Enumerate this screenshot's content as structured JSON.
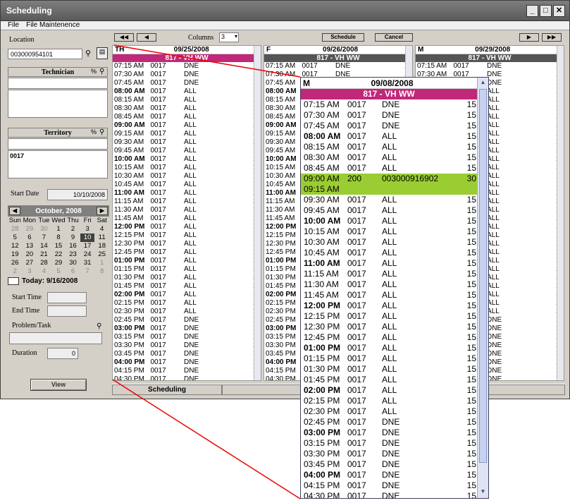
{
  "window": {
    "title": "Scheduling",
    "buttons": [
      "_",
      "□",
      "✕"
    ]
  },
  "menu": [
    "File",
    "File Maintenence"
  ],
  "left": {
    "location_label": "Location",
    "location_value": "003000954101",
    "technician_label": "Technician",
    "territory_label": "Territory",
    "territory_value": "0017",
    "pct": "%",
    "start_date_label": "Start Date",
    "start_date_value": "10/10/2008",
    "calendar": {
      "month": "October, 2008",
      "weekdays": [
        "Sun",
        "Mon",
        "Tue",
        "Wed",
        "Thu",
        "Fri",
        "Sat"
      ],
      "days": [
        [
          "28",
          "29",
          "30",
          "1",
          "2",
          "3",
          "4"
        ],
        [
          "5",
          "6",
          "7",
          "8",
          "9",
          "10",
          "11"
        ],
        [
          "12",
          "13",
          "14",
          "15",
          "16",
          "17",
          "18"
        ],
        [
          "19",
          "20",
          "21",
          "22",
          "23",
          "24",
          "25"
        ],
        [
          "26",
          "27",
          "28",
          "29",
          "30",
          "31",
          "1"
        ],
        [
          "2",
          "3",
          "4",
          "5",
          "6",
          "7",
          "8"
        ]
      ],
      "today": "Today: 9/16/2008"
    },
    "start_time_label": "Start Time",
    "end_time_label": "End Time",
    "problem_label": "Problem/Task",
    "duration_label": "Duration",
    "duration_value": "0",
    "view_button": "View"
  },
  "toolbar": {
    "columns_label": "Columns",
    "columns_value": "3",
    "schedule": "Schedule",
    "cancel": "Cancel"
  },
  "columns": [
    {
      "day": "TH",
      "date": "09/25/2008",
      "band": "817 - VH WW",
      "band_color": "#c0287a"
    },
    {
      "day": "F",
      "date": "09/26/2008",
      "band": "817 - VH WW",
      "band_color": "#555555"
    },
    {
      "day": "M",
      "date": "09/29/2008",
      "band": "817 - VH WW",
      "band_color": "#555555"
    }
  ],
  "rows": [
    [
      "07:15 AM",
      "0017",
      "DNE",
      "15"
    ],
    [
      "07:30 AM",
      "0017",
      "DNE",
      "15"
    ],
    [
      "07:45 AM",
      "0017",
      "DNE",
      "15"
    ],
    [
      "08:00 AM",
      "0017",
      "ALL",
      "15"
    ],
    [
      "08:15 AM",
      "0017",
      "ALL",
      "15"
    ],
    [
      "08:30 AM",
      "0017",
      "ALL",
      "15"
    ],
    [
      "08:45 AM",
      "0017",
      "ALL",
      "15"
    ],
    [
      "09:00 AM",
      "0017",
      "ALL",
      "15"
    ],
    [
      "09:15 AM",
      "0017",
      "ALL",
      "15"
    ],
    [
      "09:30 AM",
      "0017",
      "ALL",
      "15"
    ],
    [
      "09:45 AM",
      "0017",
      "ALL",
      "15"
    ],
    [
      "10:00 AM",
      "0017",
      "ALL",
      "15"
    ],
    [
      "10:15 AM",
      "0017",
      "ALL",
      "15"
    ],
    [
      "10:30 AM",
      "0017",
      "ALL",
      "15"
    ],
    [
      "10:45 AM",
      "0017",
      "ALL",
      "15"
    ],
    [
      "11:00 AM",
      "0017",
      "ALL",
      "15"
    ],
    [
      "11:15 AM",
      "0017",
      "ALL",
      "15"
    ],
    [
      "11:30 AM",
      "0017",
      "ALL",
      "15"
    ],
    [
      "11:45 AM",
      "0017",
      "ALL",
      "15"
    ],
    [
      "12:00 PM",
      "0017",
      "ALL",
      "15"
    ],
    [
      "12:15 PM",
      "0017",
      "ALL",
      "15"
    ],
    [
      "12:30 PM",
      "0017",
      "ALL",
      "15"
    ],
    [
      "12:45 PM",
      "0017",
      "ALL",
      "15"
    ],
    [
      "01:00 PM",
      "0017",
      "ALL",
      "15"
    ],
    [
      "01:15 PM",
      "0017",
      "ALL",
      "15"
    ],
    [
      "01:30 PM",
      "0017",
      "ALL",
      "15"
    ],
    [
      "01:45 PM",
      "0017",
      "ALL",
      "15"
    ],
    [
      "02:00 PM",
      "0017",
      "ALL",
      "15"
    ],
    [
      "02:15 PM",
      "0017",
      "ALL",
      "15"
    ],
    [
      "02:30 PM",
      "0017",
      "ALL",
      "15"
    ],
    [
      "02:45 PM",
      "0017",
      "DNE",
      "15"
    ],
    [
      "03:00 PM",
      "0017",
      "DNE",
      "15"
    ],
    [
      "03:15 PM",
      "0017",
      "DNE",
      "15"
    ],
    [
      "03:30 PM",
      "0017",
      "DNE",
      "15"
    ],
    [
      "03:45 PM",
      "0017",
      "DNE",
      "15"
    ],
    [
      "04:00 PM",
      "0017",
      "DNE",
      "15"
    ],
    [
      "04:15 PM",
      "0017",
      "DNE",
      "15"
    ],
    [
      "04:30 PM",
      "0017",
      "DNE",
      "15"
    ]
  ],
  "popup": {
    "day": "M",
    "date": "09/08/2008",
    "band": "817 - VH WW",
    "band_color": "#c0287a",
    "highlight_color": "#9acd32",
    "rows": [
      [
        "07:15 AM",
        "0017",
        "DNE",
        "15"
      ],
      [
        "07:30 AM",
        "0017",
        "DNE",
        "15"
      ],
      [
        "07:45 AM",
        "0017",
        "DNE",
        "15"
      ],
      [
        "08:00 AM",
        "0017",
        "ALL",
        "15"
      ],
      [
        "08:15 AM",
        "0017",
        "ALL",
        "15"
      ],
      [
        "08:30 AM",
        "0017",
        "ALL",
        "15"
      ],
      [
        "08:45 AM",
        "0017",
        "ALL",
        "15"
      ],
      [
        "09:00 AM",
        "200",
        "003000916902",
        "30"
      ],
      [
        "09:15 AM",
        "",
        "",
        ""
      ],
      [
        "09:30 AM",
        "0017",
        "ALL",
        "15"
      ],
      [
        "09:45 AM",
        "0017",
        "ALL",
        "15"
      ],
      [
        "10:00 AM",
        "0017",
        "ALL",
        "15"
      ],
      [
        "10:15 AM",
        "0017",
        "ALL",
        "15"
      ],
      [
        "10:30 AM",
        "0017",
        "ALL",
        "15"
      ],
      [
        "10:45 AM",
        "0017",
        "ALL",
        "15"
      ],
      [
        "11:00 AM",
        "0017",
        "ALL",
        "15"
      ],
      [
        "11:15 AM",
        "0017",
        "ALL",
        "15"
      ],
      [
        "11:30 AM",
        "0017",
        "ALL",
        "15"
      ],
      [
        "11:45 AM",
        "0017",
        "ALL",
        "15"
      ],
      [
        "12:00 PM",
        "0017",
        "ALL",
        "15"
      ],
      [
        "12:15 PM",
        "0017",
        "ALL",
        "15"
      ],
      [
        "12:30 PM",
        "0017",
        "ALL",
        "15"
      ],
      [
        "12:45 PM",
        "0017",
        "ALL",
        "15"
      ],
      [
        "01:00 PM",
        "0017",
        "ALL",
        "15"
      ],
      [
        "01:15 PM",
        "0017",
        "ALL",
        "15"
      ],
      [
        "01:30 PM",
        "0017",
        "ALL",
        "15"
      ],
      [
        "01:45 PM",
        "0017",
        "ALL",
        "15"
      ],
      [
        "02:00 PM",
        "0017",
        "ALL",
        "15"
      ],
      [
        "02:15 PM",
        "0017",
        "ALL",
        "15"
      ],
      [
        "02:30 PM",
        "0017",
        "ALL",
        "15"
      ],
      [
        "02:45 PM",
        "0017",
        "DNE",
        "15"
      ],
      [
        "03:00 PM",
        "0017",
        "DNE",
        "15"
      ],
      [
        "03:15 PM",
        "0017",
        "DNE",
        "15"
      ],
      [
        "03:30 PM",
        "0017",
        "DNE",
        "15"
      ],
      [
        "03:45 PM",
        "0017",
        "DNE",
        "15"
      ],
      [
        "04:00 PM",
        "0017",
        "DNE",
        "15"
      ],
      [
        "04:15 PM",
        "0017",
        "DNE",
        "15"
      ],
      [
        "04:30 PM",
        "0017",
        "DNE",
        "15"
      ]
    ]
  },
  "status": {
    "tab": "Scheduling"
  }
}
